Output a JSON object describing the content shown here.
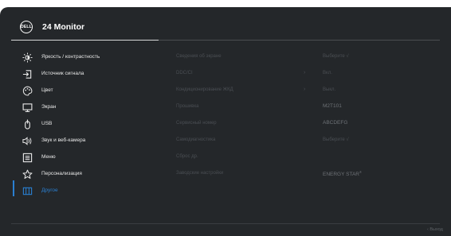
{
  "header": {
    "logo_text": "DELL",
    "title": "24 Monitor"
  },
  "menu": {
    "items": [
      {
        "label": "Яркость / контрастность",
        "icon": "brightness-icon"
      },
      {
        "label": "Источник сигнала",
        "icon": "input-source-icon"
      },
      {
        "label": "Цвет",
        "icon": "color-palette-icon"
      },
      {
        "label": "Экран",
        "icon": "display-icon"
      },
      {
        "label": "USB",
        "icon": "usb-icon"
      },
      {
        "label": "Звук и веб-камера",
        "icon": "speaker-camera-icon"
      },
      {
        "label": "Меню",
        "icon": "menu-icon"
      },
      {
        "label": "Персонализация",
        "icon": "star-icon"
      },
      {
        "label": "Другое",
        "icon": "other-icon",
        "active": true
      }
    ]
  },
  "submenu": {
    "rows": [
      {
        "label": "Сведения об экране",
        "value": "Выберите √",
        "chevron": ""
      },
      {
        "label": "DDC/CI",
        "value": "Вкл.",
        "chevron": "›"
      },
      {
        "label": "Кондиционирование ЖКД",
        "value": "Выкл.",
        "chevron": "›"
      },
      {
        "label": "Прошивка",
        "value": "M2T101",
        "chevron": ""
      },
      {
        "label": "Сервисный номер",
        "value": "ABCDEFG",
        "chevron": ""
      },
      {
        "label": "Самодиагностика",
        "value": "Выберите √",
        "chevron": ""
      },
      {
        "label": "Сброс др.",
        "value": "",
        "chevron": ""
      },
      {
        "label": "Заводские настройки",
        "value": "ENERGY STAR",
        "value_sup": "®",
        "chevron": ""
      }
    ]
  },
  "footer": {
    "exit_label": "‹ Выход"
  },
  "colors": {
    "background": "#24272a",
    "accent": "#2a7fd1",
    "text": "#e8e8e8",
    "dim_text": "#4a4e53"
  }
}
